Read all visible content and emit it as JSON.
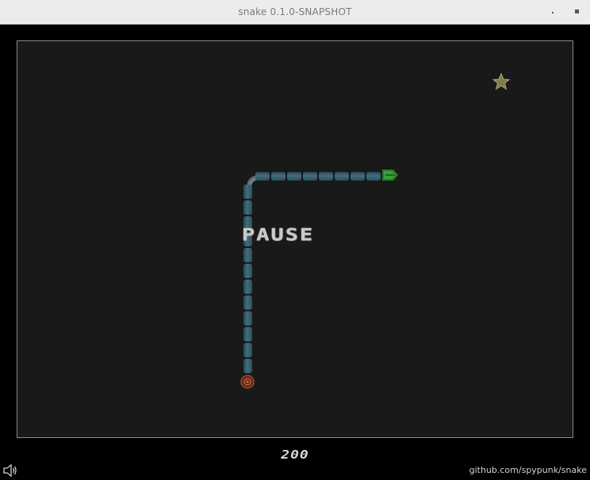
{
  "window": {
    "title": "snake 0.1.0-SNAPSHOT"
  },
  "game": {
    "status": "PAUSE",
    "score": "200",
    "snake_length": 20,
    "colors": {
      "board": "#191919",
      "snake_body": "#3f6f80",
      "snake_head": "#2e8a2e",
      "tail": "#a0452a",
      "food": "#8a8a5a"
    }
  },
  "footer": {
    "link": "github.com/spypunk/snake",
    "sound_icon": "speaker-icon"
  }
}
